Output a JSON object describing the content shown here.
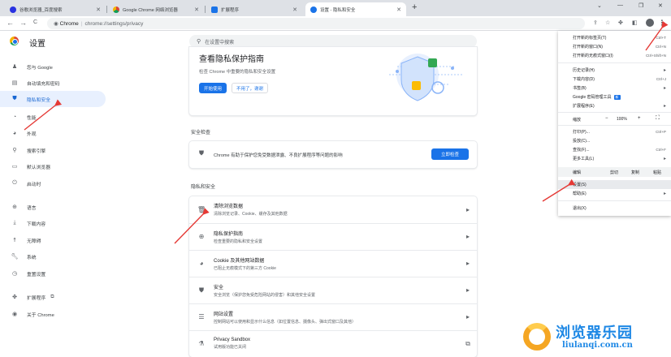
{
  "tabs": [
    {
      "title": "谷歌浏览器_百度搜索",
      "favicon_color": "#2932e1"
    },
    {
      "title": "Google Chrome 网络浏览器",
      "favicon_color": "#4285f4"
    },
    {
      "title": "扩展程序",
      "favicon_color": "#1a73e8"
    },
    {
      "title": "设置 - 隐私和安全",
      "favicon_color": "#1a73e8"
    }
  ],
  "window_controls": {
    "chevron": "⌄",
    "minimize": "—",
    "restore": "❐",
    "close": "✕"
  },
  "toolbar": {
    "back": "←",
    "forward": "→",
    "reload": "C",
    "security_label": "Chrome",
    "url": "chrome://settings/privacy"
  },
  "settings": {
    "title": "设置",
    "search_placeholder": "在设置中搜索"
  },
  "sidebar": {
    "items": [
      {
        "label": "您与 Google",
        "icon": "person-icon"
      },
      {
        "label": "自动填充和密码",
        "icon": "clipboard-icon"
      },
      {
        "label": "隐私和安全",
        "icon": "shield-icon",
        "active": true
      },
      {
        "label": "性能",
        "icon": "speedometer-icon"
      },
      {
        "label": "外观",
        "icon": "palette-icon"
      },
      {
        "label": "搜索引擎",
        "icon": "search-icon"
      },
      {
        "label": "默认浏览器",
        "icon": "browser-icon"
      },
      {
        "label": "启动时",
        "icon": "power-icon"
      },
      {
        "label": "语言",
        "icon": "globe-icon"
      },
      {
        "label": "下载内容",
        "icon": "download-icon"
      },
      {
        "label": "无障碍",
        "icon": "accessibility-icon"
      },
      {
        "label": "系统",
        "icon": "wrench-icon"
      },
      {
        "label": "重置设置",
        "icon": "restore-icon"
      },
      {
        "label": "扩展程序",
        "icon": "puzzle-icon"
      },
      {
        "label": "关于 Chrome",
        "icon": "chrome-icon"
      }
    ]
  },
  "privacy_guide": {
    "title": "查看隐私保护指南",
    "description": "检查 Chrome 中重要的隐私和安全设置",
    "start_button": "开始使用",
    "dismiss_button": "不用了，谢谢"
  },
  "safety_check": {
    "section_title": "安全检查",
    "description": "Chrome 有助于保护您免受数据泄露、不良扩展程序等问题的影响",
    "button": "立即检查"
  },
  "privacy_section": {
    "section_title": "隐私和安全",
    "rows": [
      {
        "title": "清除浏览数据",
        "subtitle": "清除浏览记录、Cookie、缓存及其他数据",
        "icon": "trash-icon"
      },
      {
        "title": "隐私保护指南",
        "subtitle": "检查重要的隐私和安全设置",
        "icon": "compass-icon"
      },
      {
        "title": "Cookie 及其他网站数据",
        "subtitle": "已阻止无痕模式下的第三方 Cookie",
        "icon": "cookie-icon"
      },
      {
        "title": "安全",
        "subtitle": "安全浏览（保护您免受危险网站的侵害）和其他安全设置",
        "icon": "shield-icon"
      },
      {
        "title": "网站设置",
        "subtitle": "控制网站可以使用和显示什么信息（如位置信息、摄像头、弹出式窗口及其他）",
        "icon": "sliders-icon"
      },
      {
        "title": "Privacy Sandbox",
        "subtitle": "试用版功能已关闭",
        "icon": "flask-icon"
      }
    ]
  },
  "menu": {
    "group1": [
      {
        "label": "打开新的标签页(T)",
        "shortcut": "Ctrl+T"
      },
      {
        "label": "打开新的窗口(N)",
        "shortcut": "Ctrl+N"
      },
      {
        "label": "打开新的无痕式窗口(I)",
        "shortcut": "Ctrl+Shift+N"
      }
    ],
    "group2": [
      {
        "label": "历史记录(H)",
        "shortcut": "",
        "arrow": "▸"
      },
      {
        "label": "下载内容(D)",
        "shortcut": "Ctrl+J",
        "arrow": ""
      },
      {
        "label": "书签(B)",
        "shortcut": "",
        "arrow": "▸"
      },
      {
        "label": "Google 密码管理工具",
        "shortcut": "",
        "arrow": "",
        "badge": "新"
      },
      {
        "label": "扩展程序(E)",
        "shortcut": "",
        "arrow": "▸"
      }
    ],
    "zoom": {
      "label": "缩放",
      "minus": "−",
      "value": "100%",
      "plus": "+",
      "fullscreen": "⛶"
    },
    "group3": [
      {
        "label": "打印(P)...",
        "shortcut": "Ctrl+P",
        "arrow": ""
      },
      {
        "label": "投放(C)...",
        "shortcut": "",
        "arrow": ""
      },
      {
        "label": "查找(F)...",
        "shortcut": "Ctrl+F",
        "arrow": ""
      },
      {
        "label": "更多工具(L)",
        "shortcut": "",
        "arrow": "▸"
      }
    ],
    "edit": {
      "label": "编辑",
      "cut": "剪切",
      "copy": "复制",
      "paste": "粘贴"
    },
    "group4": [
      {
        "label": "设置(S)",
        "shortcut": "",
        "arrow": "",
        "highlighted": true
      },
      {
        "label": "帮助(E)",
        "shortcut": "",
        "arrow": "▸"
      }
    ],
    "exit": "退出(X)"
  },
  "watermark": {
    "cn": "浏览器乐园",
    "en": "liulanqi.com.cn"
  },
  "colors": {
    "accent": "#1a73e8",
    "annotation_arrow": "#e53935"
  }
}
